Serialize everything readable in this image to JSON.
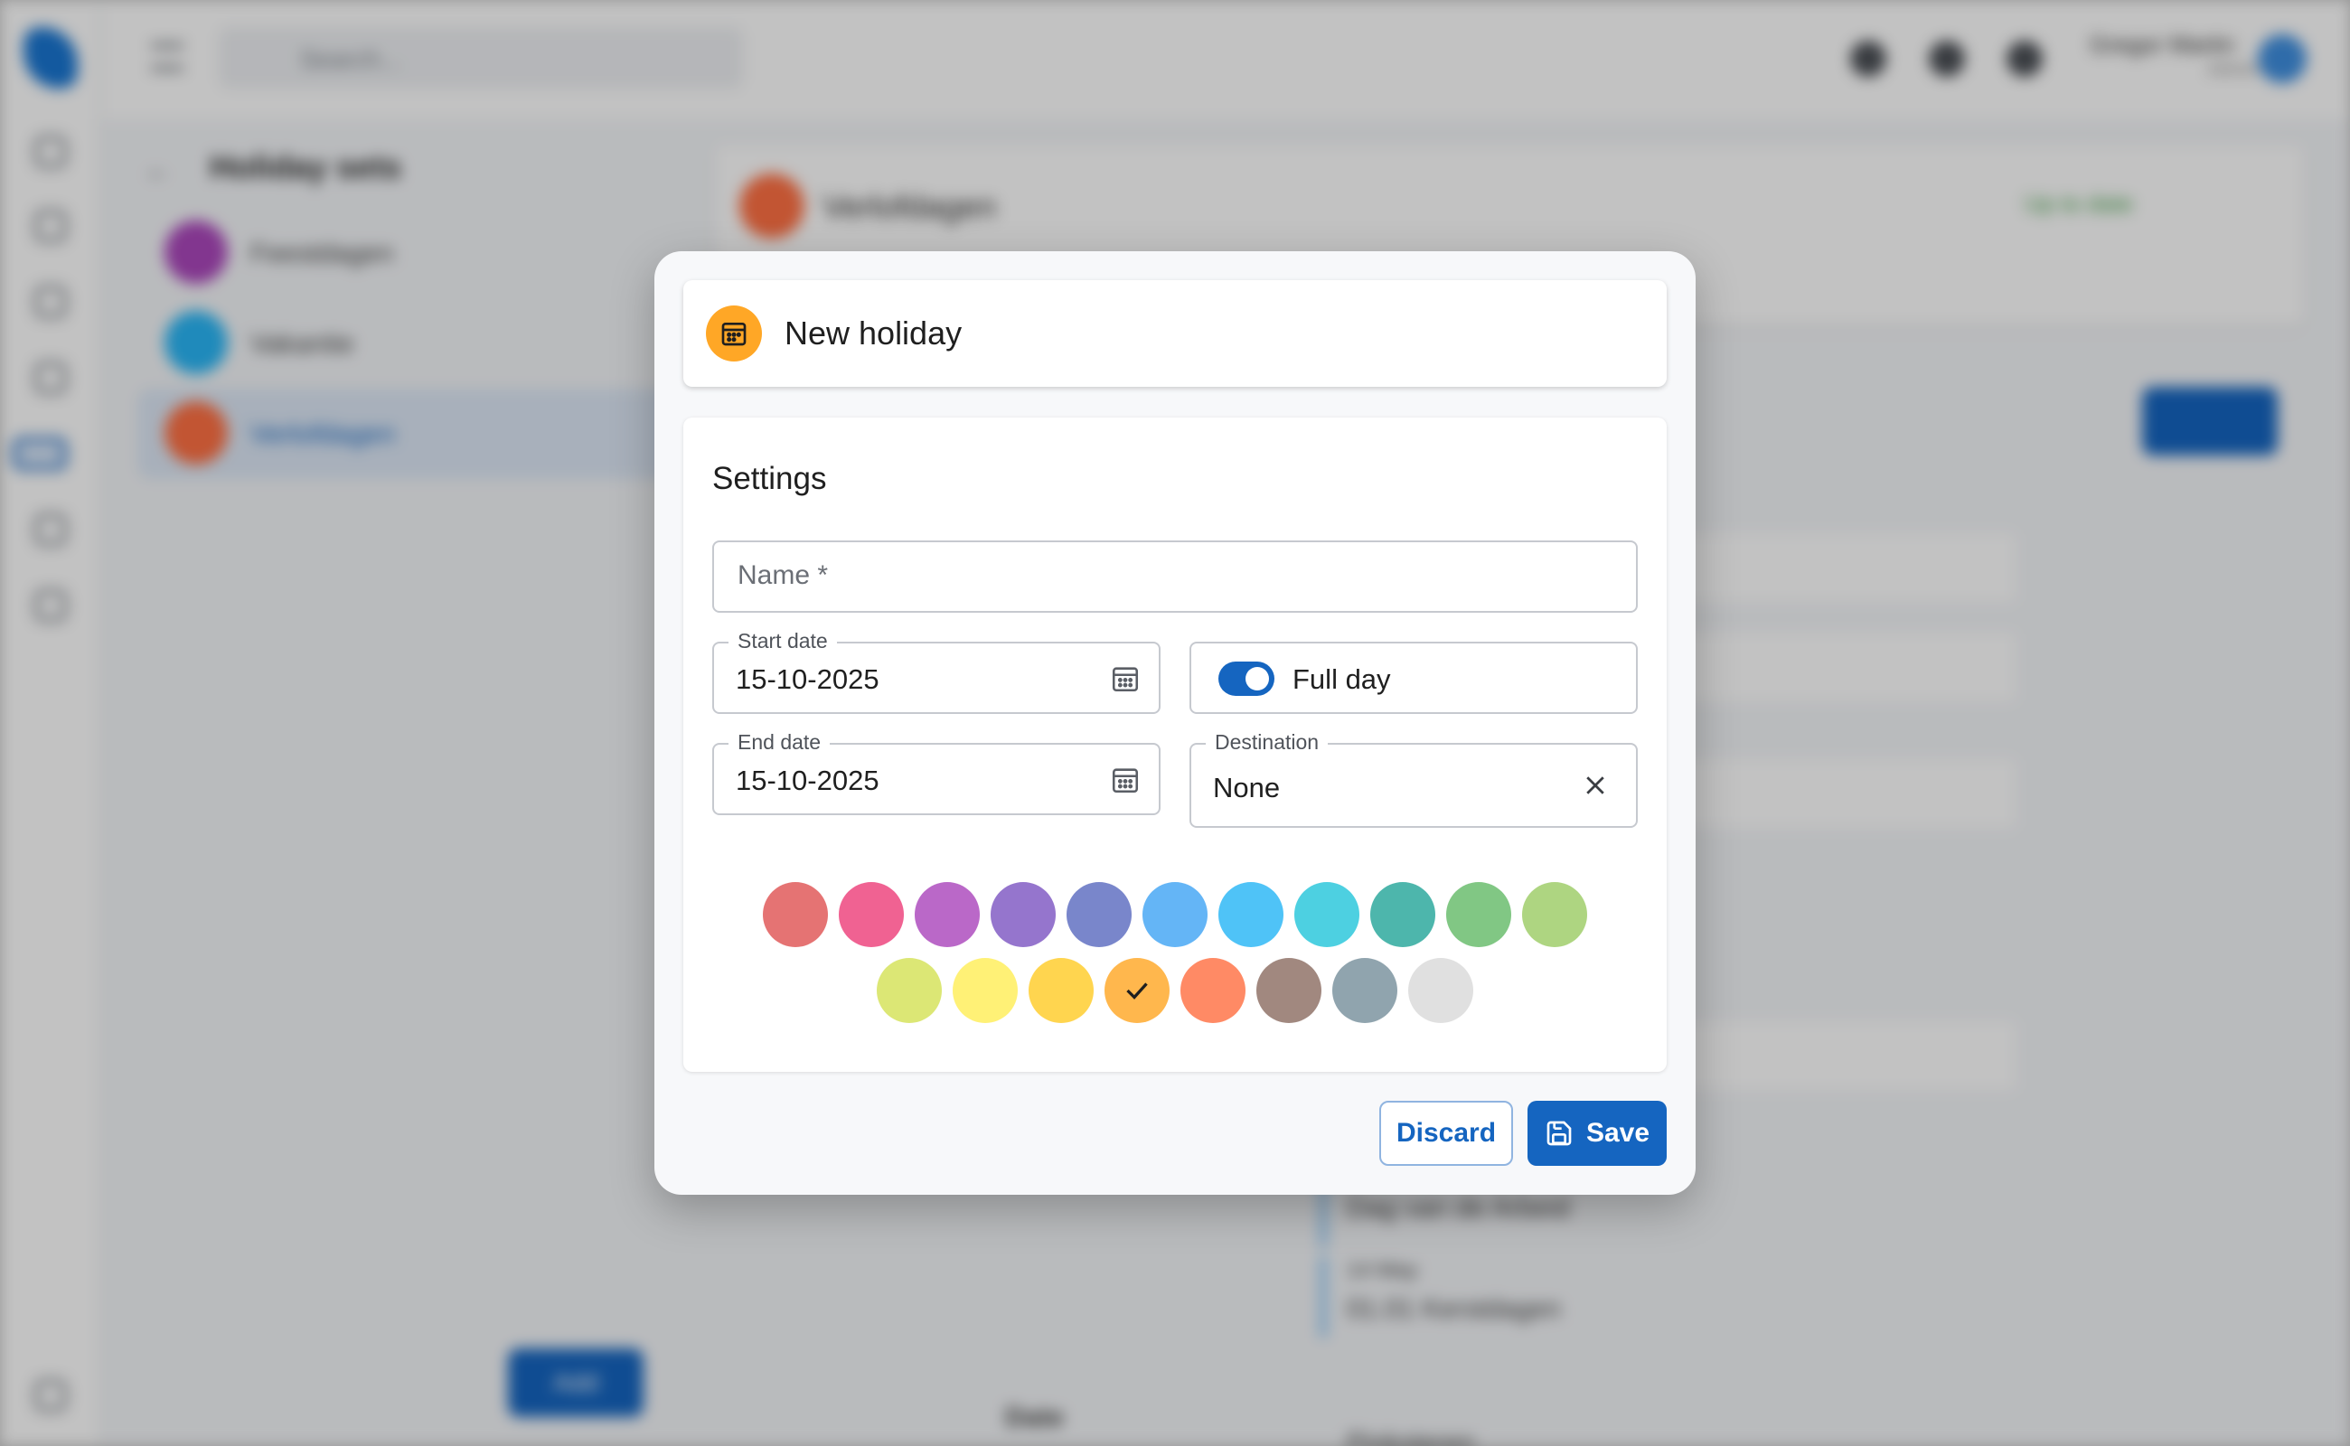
{
  "background": {
    "search_placeholder": "Search...",
    "user_name": "Gregor Martin",
    "user_role": "Admin",
    "panel_title": "Holiday sets",
    "holiday_sets": [
      {
        "label": "Feestdagen",
        "color": "#ab47bc"
      },
      {
        "label": "Vakantie",
        "color": "#29b6f6"
      },
      {
        "label": "Verlofdagen",
        "color": "#ff7043",
        "selected": true
      }
    ],
    "add_label": "Add",
    "detail_title": "Verlofdagen",
    "detail_status": "Up to date",
    "rows": [
      "Dag van de Arbeid",
      "14 May",
      "01.01 Kerstdagen",
      "Pinksteren",
      "Date"
    ]
  },
  "dialog": {
    "title": "New holiday",
    "header_icon": "calendar-icon",
    "section_title": "Settings",
    "name_field": {
      "placeholder": "Name *",
      "value": ""
    },
    "start_date": {
      "label": "Start date",
      "value": "15-10-2025"
    },
    "end_date": {
      "label": "End date",
      "value": "15-10-2025"
    },
    "full_day": {
      "label": "Full day",
      "checked": true
    },
    "destination": {
      "label": "Destination",
      "value": "None"
    },
    "colors": [
      "#e57373",
      "#f06292",
      "#ba68c8",
      "#9575cd",
      "#7986cb",
      "#64b5f6",
      "#4fc3f7",
      "#4dd0e1",
      "#4db6ac",
      "#81c784",
      "#aed581",
      "#dce775",
      "#fff176",
      "#ffd54f",
      "#ffb74d",
      "#ff8a65",
      "#a1887f",
      "#90a4ae",
      "#e0e0e0"
    ],
    "selected_color": "#ffb74d",
    "discard_label": "Discard",
    "save_label": "Save"
  }
}
